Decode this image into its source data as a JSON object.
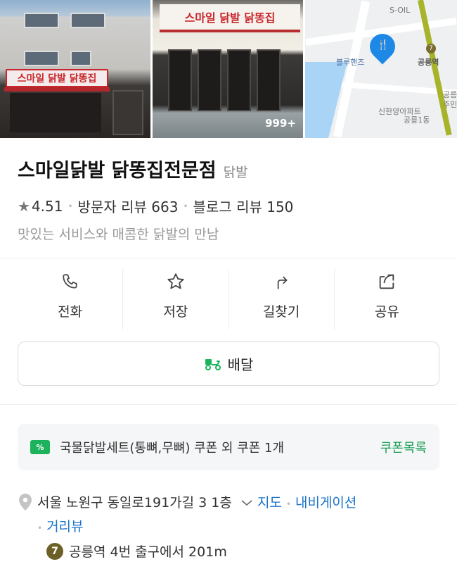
{
  "photos": {
    "photo1_sign": "스마일 닭발 닭똥집",
    "photo2_sign": "스마일 닭발 닭똥집",
    "photo_count": "999+",
    "map": {
      "labels": [
        "S-OIL",
        "블루핸즈",
        "공릉역",
        "신한양아파트",
        "공릉1동",
        "공릉",
        "주민"
      ],
      "line_number": "7",
      "colors": {
        "pin": "#1d88e6",
        "river": "#a9d4f5",
        "rail": "#a7b42a"
      }
    }
  },
  "place": {
    "name": "스마일닭발 닭똥집전문점",
    "category": "닭발",
    "rating": "4.51",
    "visitor_reviews": "방문자 리뷰 663",
    "blog_reviews": "블로그 리뷰 150",
    "description": "맛있는 서비스와 매콤한 닭발의 만남"
  },
  "actions": [
    {
      "label": "전화",
      "icon": "phone-icon"
    },
    {
      "label": "저장",
      "icon": "star-icon"
    },
    {
      "label": "길찾기",
      "icon": "directions-icon"
    },
    {
      "label": "공유",
      "icon": "share-icon"
    }
  ],
  "delivery": {
    "label": "배달",
    "icon": "delivery-scooter-icon",
    "color": "#1cb35c"
  },
  "coupon": {
    "tag": "%",
    "text": "국물닭발세트(통뼈,무뼈) 쿠폰 외 쿠폰 1개",
    "link": "쿠폰목록",
    "accent": "#1c9e56"
  },
  "address": {
    "text": "서울 노원구 동일로191가길 3 1층",
    "map_link": "지도",
    "navi_link": "내비게이션",
    "street_link": "거리뷰",
    "link_color": "#1a73c9"
  },
  "subway": {
    "line": "7",
    "text": "공릉역 4번 출구에서 201m",
    "line_color": "#6d6026"
  }
}
